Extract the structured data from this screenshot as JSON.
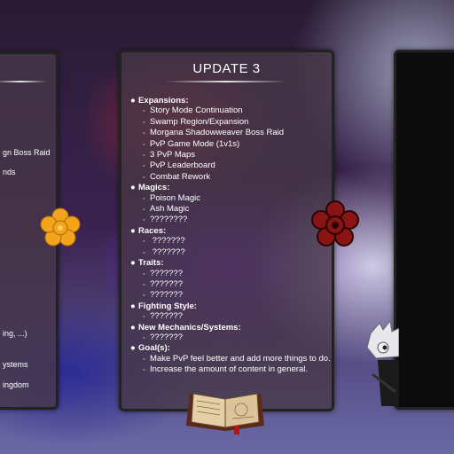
{
  "panel_left": {
    "lines": [
      "gn Boss Raid",
      "nds",
      "ing, ...)",
      "ystems",
      "ingdom"
    ]
  },
  "panel_center": {
    "title": "UPDATE 3",
    "sections": [
      {
        "heading": "Expansions:",
        "items": [
          "Story Mode Continuation",
          "Swamp Region/Expansion",
          "Morgana Shadowweaver Boss Raid",
          "PvP Game Mode (1v1s)",
          "3 PvP Maps",
          "PvP Leaderboard",
          "Combat Rework"
        ]
      },
      {
        "heading": "Magics:",
        "items": [
          "Poison Magic",
          "Ash Magic",
          "????????"
        ]
      },
      {
        "heading": "Races:",
        "items": [
          " ???????",
          " ???????"
        ]
      },
      {
        "heading": "Traits:",
        "items": [
          "???????",
          "???????",
          "???????"
        ]
      },
      {
        "heading": "Fighting Style:",
        "items": [
          "???????"
        ]
      },
      {
        "heading": "New Mechanics/Systems:",
        "items": [
          "???????"
        ]
      },
      {
        "heading": "Goal(s):",
        "items": [
          "Make PvP feel better and add more things to do.",
          "Increase the amount of content in general."
        ]
      }
    ],
    "bullet_main": "●",
    "bullet_sub": "◦"
  },
  "colors": {
    "left_emblem": "#f2a51c",
    "right_emblem": "#8a1414",
    "book": "#caa878"
  },
  "icons": {
    "left_emblem": "golden-flower-emblem-icon",
    "right_emblem": "crimson-flower-emblem-icon",
    "book": "open-spellbook-icon",
    "character": "white-haired-character-icon"
  }
}
